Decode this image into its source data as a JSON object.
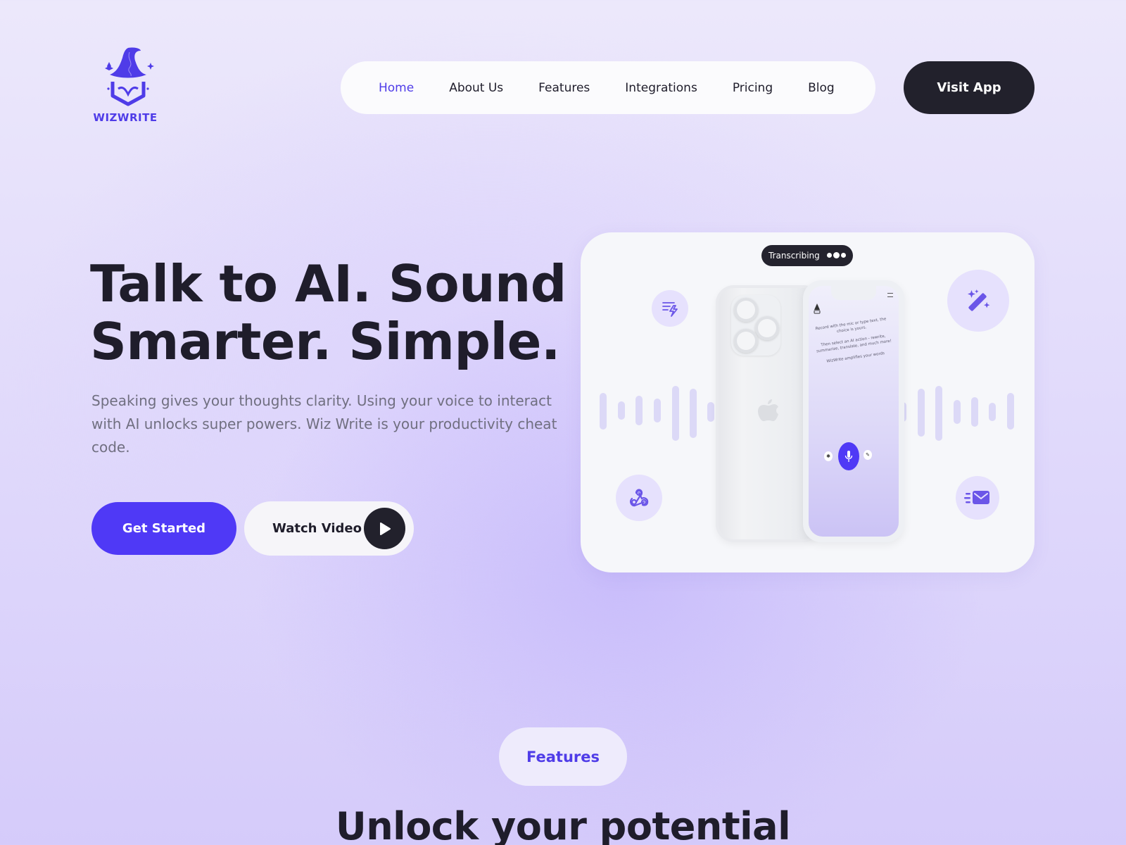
{
  "brand": {
    "name": "WIZWRITE",
    "accent": "#4f39f6",
    "dark": "#22212c"
  },
  "nav": {
    "items": [
      {
        "label": "Home",
        "active": true
      },
      {
        "label": "About Us",
        "active": false
      },
      {
        "label": "Features",
        "active": false
      },
      {
        "label": "Integrations",
        "active": false
      },
      {
        "label": "Pricing",
        "active": false
      },
      {
        "label": "Blog",
        "active": false
      }
    ],
    "cta_label": "Visit App"
  },
  "hero": {
    "title_line1": "Talk to AI. Sound",
    "title_line2": "Smarter. Simple.",
    "description": "Speaking gives your thoughts clarity. Using your voice to interact with AI unlocks super powers. Wiz Write is your productivity cheat code.",
    "primary_button": "Get Started",
    "secondary_button": "Watch Video"
  },
  "showcase": {
    "status_pill": "Transcribing",
    "icons": [
      "text-lightning-icon",
      "magic-wand-icon",
      "webhook-icon",
      "fast-mail-icon"
    ],
    "phone_screen": {
      "line1": "Record with the mic or type text, the choice is yours.",
      "line2": "Then select an AI action - rewrite, summarize, translate, and much more!",
      "line3": "WizWrite amplifies your words"
    }
  },
  "features": {
    "badge": "Features",
    "heading": "Unlock your potential"
  }
}
